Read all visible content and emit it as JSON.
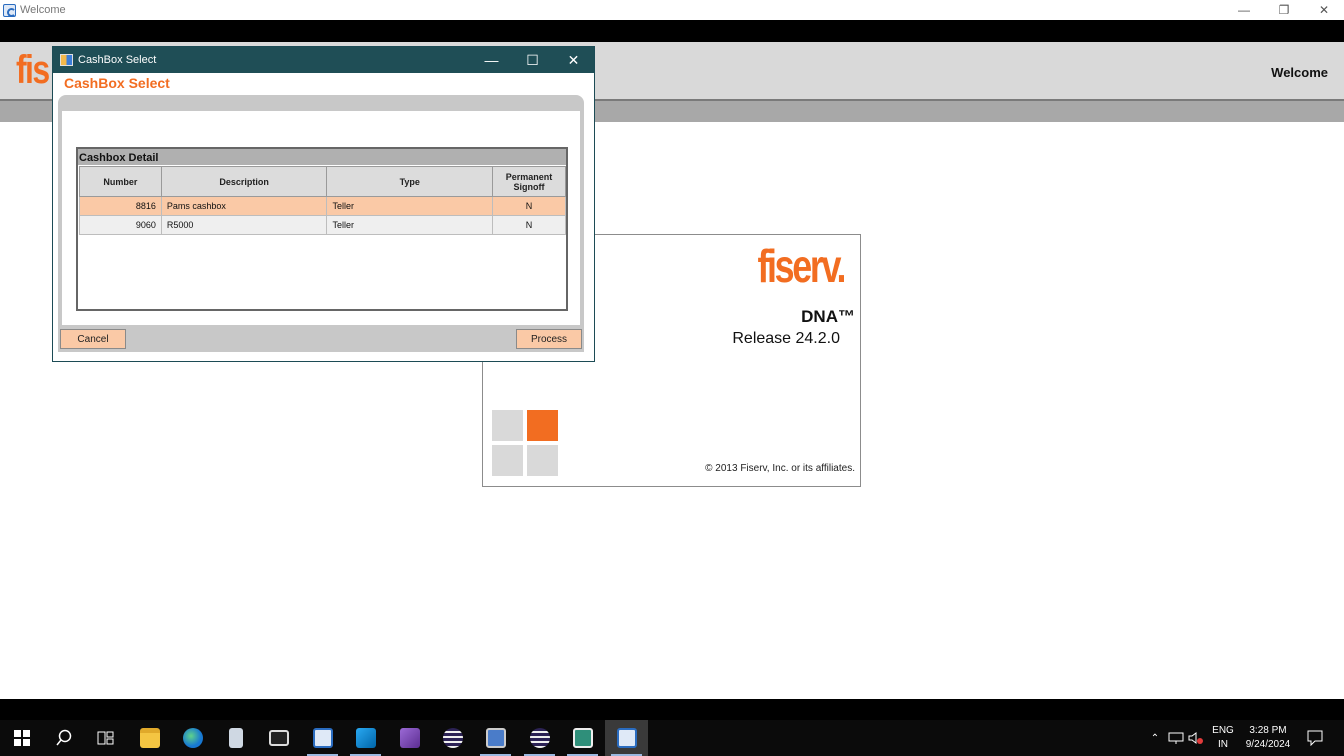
{
  "window": {
    "title": "Welcome"
  },
  "header": {
    "logo": "fis",
    "welcome": "Welcome"
  },
  "splash": {
    "brand": "fiserv.",
    "product": "DNA™",
    "release": "Release 24.2.0",
    "copyright": "© 2013 Fiserv, Inc. or its affiliates."
  },
  "dialog": {
    "title": "CashBox Select",
    "heading": "CashBox Select",
    "section": "Cashbox Detail",
    "columns": [
      "Number",
      "Description",
      "Type",
      "Permanent Signoff"
    ],
    "rows": [
      {
        "number": "8816",
        "description": "Pams cashbox",
        "type": "Teller",
        "permanent_signoff": "N"
      },
      {
        "number": "9060",
        "description": "R5000",
        "type": "Teller",
        "permanent_signoff": "N"
      }
    ],
    "cancel_label": "Cancel",
    "process_label": "Process"
  },
  "taskbar": {
    "language": "ENG",
    "region": "IN",
    "time": "3:28 PM",
    "date": "9/24/2024"
  },
  "colors": {
    "accent": "#f26d21",
    "dialog_titlebar": "#1f4e56",
    "selected_row": "#fac9a6"
  }
}
